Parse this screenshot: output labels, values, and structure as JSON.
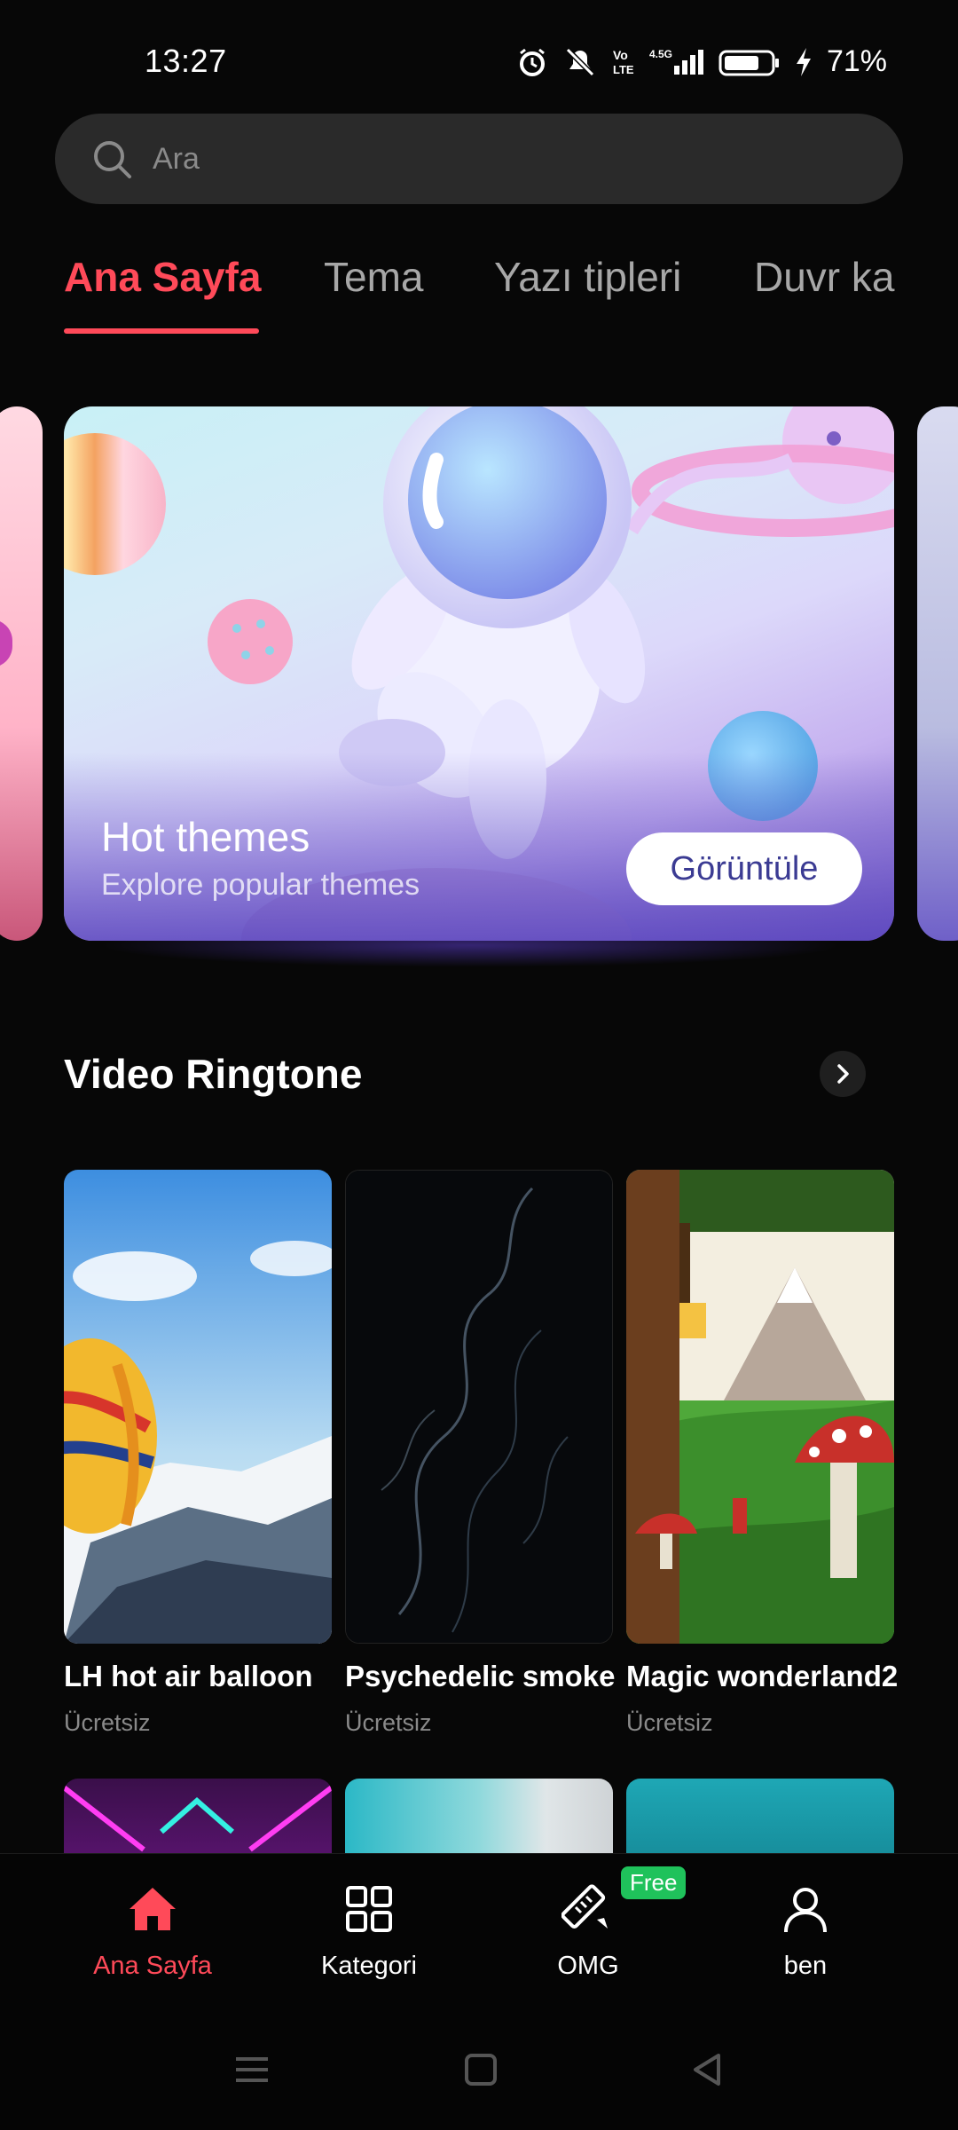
{
  "status_bar": {
    "time": "13:27",
    "battery": "71%"
  },
  "search": {
    "placeholder": "Ara"
  },
  "tabs": [
    {
      "label": "Ana Sayfa",
      "active": true
    },
    {
      "label": "Tema"
    },
    {
      "label": "Yazı tipleri"
    },
    {
      "label": "Duvr ka"
    }
  ],
  "banner": {
    "title": "Hot themes",
    "subtitle": "Explore popular themes",
    "button_label": "Görüntüle"
  },
  "section": {
    "title": "Video Ringtone"
  },
  "cards": [
    {
      "title": "LH hot air balloon",
      "price": "Ücretsiz"
    },
    {
      "title": "Psychedelic smoke",
      "price": "Ücretsiz"
    },
    {
      "title": "Magic wonderland2",
      "price": "Ücretsiz"
    }
  ],
  "bottom_nav": {
    "items": [
      {
        "label": "Ana Sayfa",
        "icon": "home-icon",
        "active": true
      },
      {
        "label": "Kategori",
        "icon": "grid-icon"
      },
      {
        "label": "OMG",
        "icon": "ruler-pencil-icon"
      },
      {
        "label": "ben",
        "icon": "person-icon"
      }
    ],
    "badge": "Free"
  },
  "colors": {
    "accent": "#ff4a59",
    "background": "#070707",
    "badge": "#1fc25b"
  }
}
